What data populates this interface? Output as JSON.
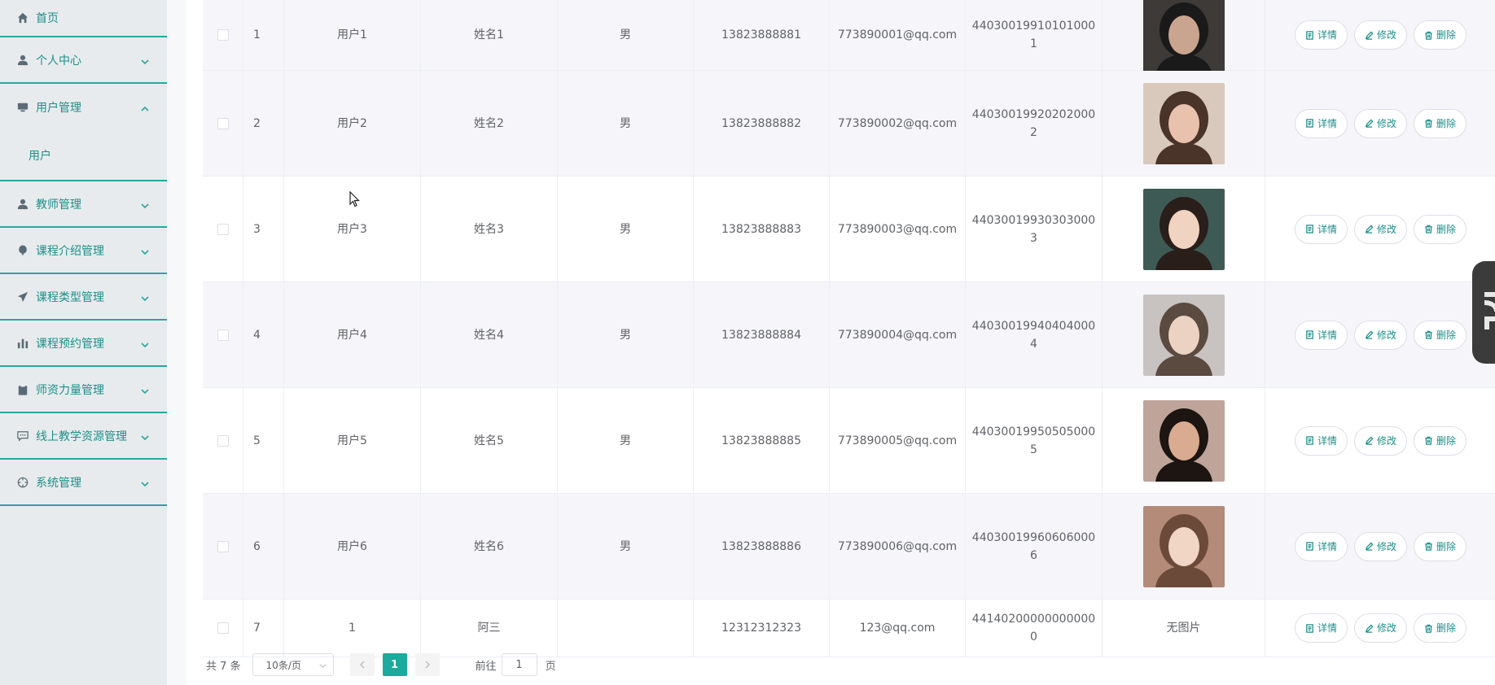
{
  "sidebar": {
    "items": [
      {
        "label": "首页",
        "icon": "home-icon"
      },
      {
        "label": "个人中心",
        "icon": "person-icon"
      },
      {
        "label": "用户管理",
        "icon": "monitor-icon",
        "sub": "用户"
      },
      {
        "label": "教师管理",
        "icon": "person-icon"
      },
      {
        "label": "课程介绍管理",
        "icon": "balloon-icon"
      },
      {
        "label": "课程类型管理",
        "icon": "paper-plane-icon"
      },
      {
        "label": "课程预约管理",
        "icon": "bar-chart-icon"
      },
      {
        "label": "师资力量管理",
        "icon": "clipboard-icon"
      },
      {
        "label": "线上教学资源管理",
        "icon": "chat-icon"
      },
      {
        "label": "系统管理",
        "icon": "compass-icon"
      }
    ]
  },
  "actions": {
    "detail": "详情",
    "edit": "修改",
    "delete": "删除"
  },
  "rows": [
    {
      "idx": "1",
      "user": "用户1",
      "name": "姓名1",
      "sex": "男",
      "phone": "13823888881",
      "email": "773890001@qq.com",
      "idcard": "440300199101010001",
      "photo": "portrait-man-dark"
    },
    {
      "idx": "2",
      "user": "用户2",
      "name": "姓名2",
      "sex": "男",
      "phone": "13823888882",
      "email": "773890002@qq.com",
      "idcard": "440300199202020002",
      "photo": "portrait-woman-curly"
    },
    {
      "idx": "3",
      "user": "用户3",
      "name": "姓名3",
      "sex": "男",
      "phone": "13823888883",
      "email": "773890003@qq.com",
      "idcard": "440300199303030003",
      "photo": "portrait-woman-profile"
    },
    {
      "idx": "4",
      "user": "用户4",
      "name": "姓名4",
      "sex": "男",
      "phone": "13823888884",
      "email": "773890004@qq.com",
      "idcard": "440300199404040004",
      "photo": "portrait-woman-short"
    },
    {
      "idx": "5",
      "user": "用户5",
      "name": "姓名5",
      "sex": "男",
      "phone": "13823888885",
      "email": "773890005@qq.com",
      "idcard": "440300199505050005",
      "photo": "portrait-man-beard"
    },
    {
      "idx": "6",
      "user": "用户6",
      "name": "姓名6",
      "sex": "男",
      "phone": "13823888886",
      "email": "773890006@qq.com",
      "idcard": "440300199606060006",
      "photo": "portrait-girl"
    },
    {
      "idx": "7",
      "user": "1",
      "name": "阿三",
      "sex": "",
      "phone": "12312312323",
      "email": "123@qq.com",
      "idcard": "441402000000000000",
      "photo_text": "无图片"
    }
  ],
  "pager": {
    "total": "共 7 条",
    "size": "10条/页",
    "current": "1",
    "goto_label": "前往",
    "goto_value": "1",
    "page_suffix": "页"
  },
  "colors": {
    "accent": "#1aaa9e",
    "menu_text": "#1c8f8a",
    "divider": "#2aa6a1"
  }
}
